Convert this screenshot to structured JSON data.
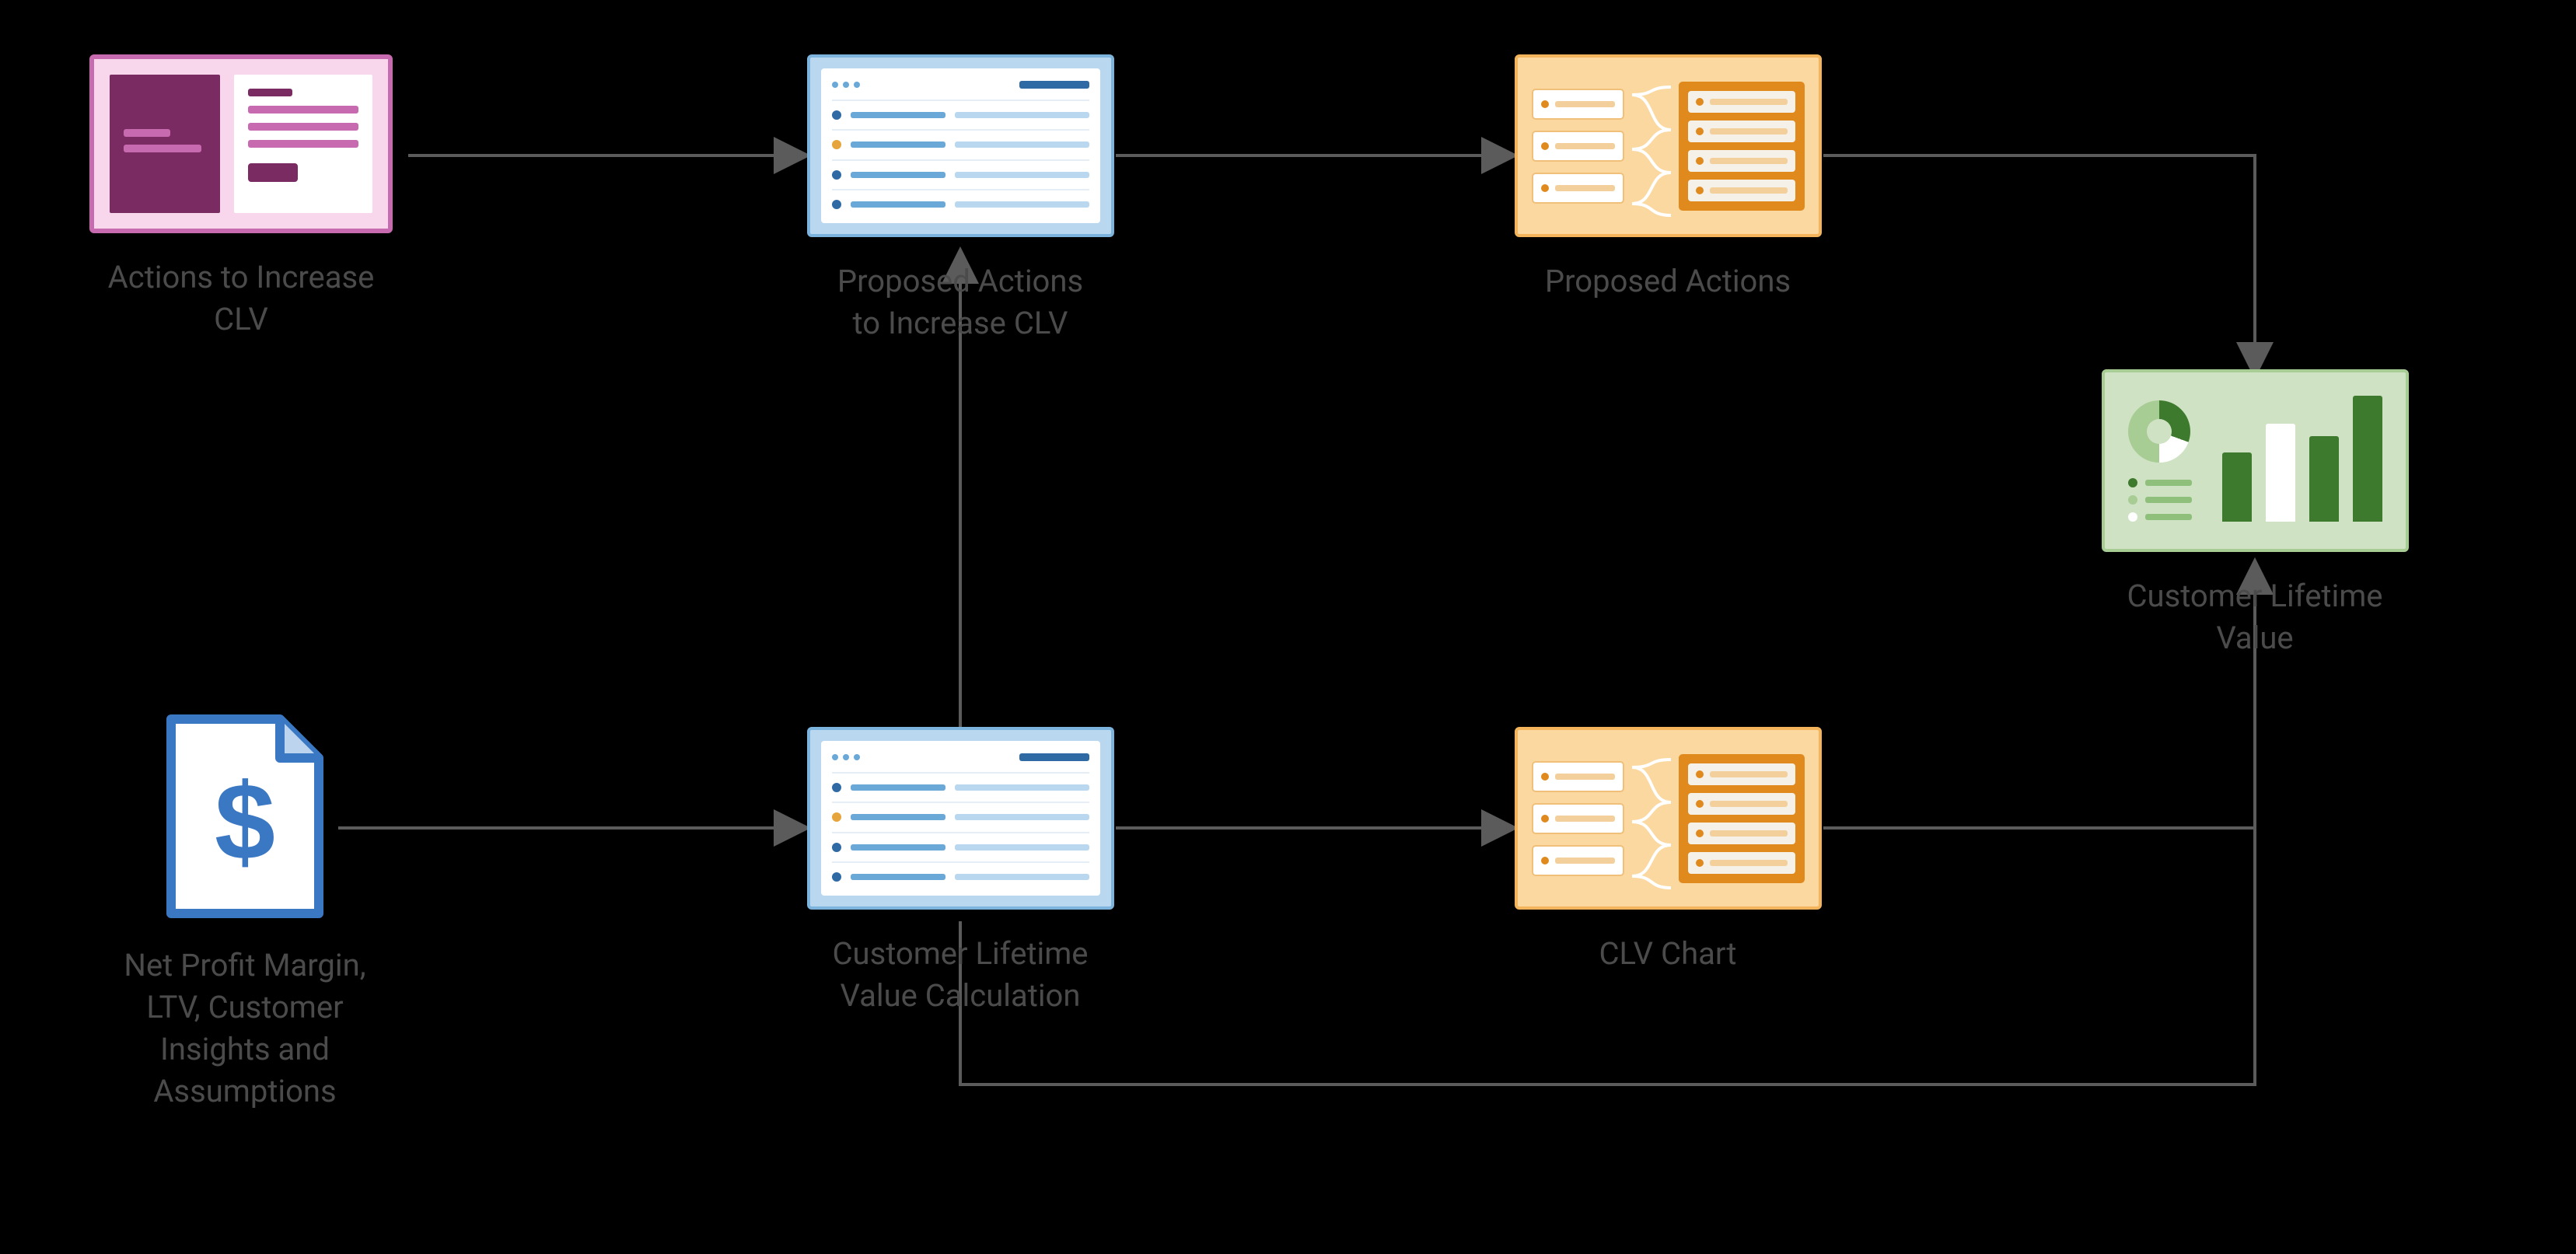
{
  "nodes": {
    "actions_increase_clv": {
      "label": "Actions to Increase\nCLV"
    },
    "proposed_actions_clv": {
      "label": "Proposed Actions\nto Increase CLV"
    },
    "proposed_actions": {
      "label": "Proposed Actions"
    },
    "net_profit": {
      "label": "Net Profit Margin,\nLTV, Customer\nInsights and\nAssumptions"
    },
    "clv_calc": {
      "label": "Customer Lifetime\nValue Calculation"
    },
    "clv_chart": {
      "label": "CLV Chart"
    },
    "clv_dashboard": {
      "label": "Customer Lifetime\nValue"
    }
  },
  "edges": [
    {
      "from": "actions_increase_clv",
      "to": "proposed_actions_clv"
    },
    {
      "from": "proposed_actions_clv",
      "to": "proposed_actions"
    },
    {
      "from": "proposed_actions",
      "to": "clv_dashboard"
    },
    {
      "from": "net_profit",
      "to": "clv_calc"
    },
    {
      "from": "clv_calc",
      "to": "proposed_actions_clv"
    },
    {
      "from": "clv_calc",
      "to": "clv_chart"
    },
    {
      "from": "clv_chart",
      "to": "clv_dashboard"
    },
    {
      "from": "clv_calc",
      "to": "clv_dashboard"
    }
  ]
}
